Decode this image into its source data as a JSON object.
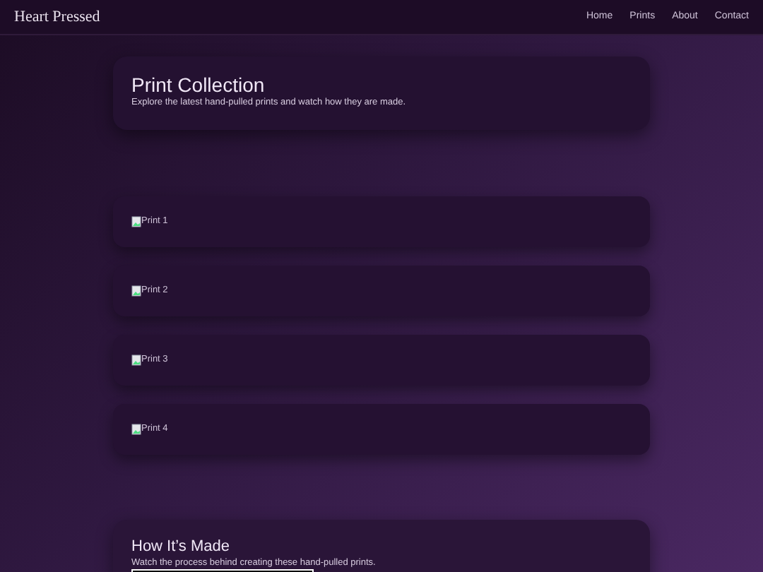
{
  "header": {
    "brand": "Heart Pressed",
    "nav": [
      {
        "label": "Home"
      },
      {
        "label": "Prints"
      },
      {
        "label": "About"
      },
      {
        "label": "Contact"
      }
    ]
  },
  "hero": {
    "title": "Print Collection",
    "subtitle": "Explore the latest hand-pulled prints and watch how they are made."
  },
  "prints": [
    {
      "alt": "Print 1"
    },
    {
      "alt": "Print 2"
    },
    {
      "alt": "Print 3"
    },
    {
      "alt": "Print 4"
    }
  ],
  "video_section": {
    "title": "How It’s Made",
    "subtitle": "Watch the process behind creating these hand-pulled prints."
  }
}
